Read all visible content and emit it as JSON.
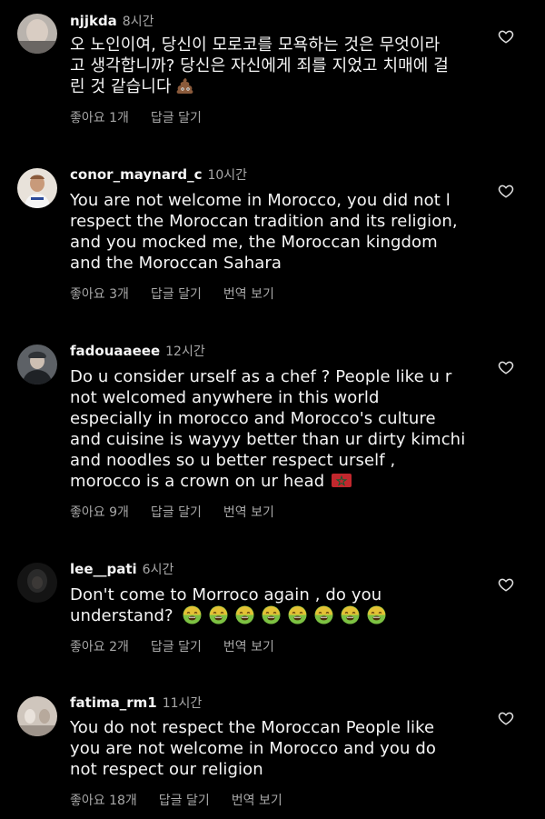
{
  "comments": [
    {
      "username": "njjkda",
      "time": "8시간",
      "lines": [
        "오 노인이여, 당신이 모로코를 모욕하는 것은 무엇이라",
        "고 생각합니까? 당신은 자신에게 죄를 지었고 치매에 걸",
        "린 것 같습니다"
      ],
      "likes": "좋아요 1개",
      "reply": "답글 달기",
      "translate": ""
    },
    {
      "username": "conor_maynard_c",
      "time": "10시간",
      "lines": [
        "You are not welcome in Morocco, you did not l",
        "respect the Moroccan tradition and its religion,",
        "and you mocked me, the Moroccan kingdom",
        "and the Moroccan Sahara"
      ],
      "likes": "좋아요 3개",
      "reply": "답글 달기",
      "translate": "번역 보기"
    },
    {
      "username": "fadouaaeee",
      "time": "12시간",
      "lines": [
        "Do u consider urself as a chef ? People like u r",
        "not welcomed anywhere in this world",
        "especially in morocco and Morocco's culture",
        "and cuisine is wayyy better than ur dirty kimchi",
        "and noodles so u better respect urself ,",
        "morocco is a crown on ur head"
      ],
      "likes": "좋아요 9개",
      "reply": "답글 달기",
      "translate": "번역 보기"
    },
    {
      "username": "lee__pati",
      "time": "6시간",
      "lines": [
        "Don't come to Morroco again , do you",
        "understand?"
      ],
      "likes": "좋아요 2개",
      "reply": "답글 달기",
      "translate": "번역 보기"
    },
    {
      "username": "fatima_rm1",
      "time": "11시간",
      "lines": [
        "You do not respect the Moroccan People like",
        "you are not welcome in Morocco and you do",
        "not respect our religion"
      ],
      "likes": "좋아요 18개",
      "reply": "답글 달기",
      "translate": "번역 보기"
    }
  ],
  "icons": {
    "like": "heart-outline-icon",
    "poop": "pile-of-poo-emoji",
    "flag": "morocco-flag-emoji",
    "nauseated": "nauseated-face-emoji"
  },
  "colors": {
    "background": "#000000",
    "text": "#f5f5f5",
    "secondary": "#a8a8a8",
    "flag_red": "#c1272d",
    "flag_green": "#006233",
    "emoji_green": "#7cc142",
    "emoji_yellow": "#f7c232"
  }
}
